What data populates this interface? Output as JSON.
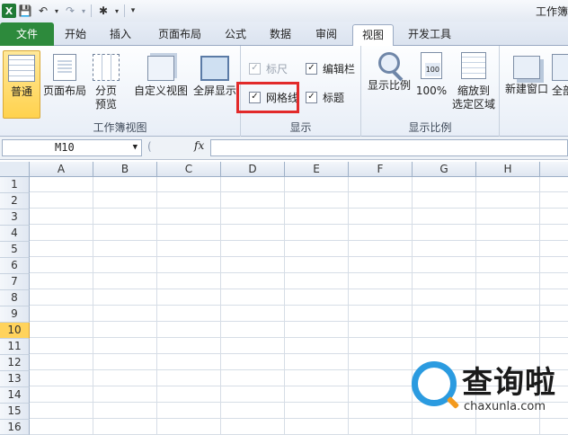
{
  "title_bar": {
    "window_title": "工作簿"
  },
  "tabs": [
    {
      "label": "文件"
    },
    {
      "label": "开始"
    },
    {
      "label": "插入"
    },
    {
      "label": "页面布局"
    },
    {
      "label": "公式"
    },
    {
      "label": "数据"
    },
    {
      "label": "审阅"
    },
    {
      "label": "视图"
    },
    {
      "label": "开发工具"
    }
  ],
  "active_tab": "视图",
  "ribbon": {
    "workbook_views": {
      "label": "工作簿视图",
      "normal": "普通",
      "page_layout": "页面布局",
      "page_break": [
        "分页",
        "预览"
      ],
      "custom_views": "自定义视图",
      "full_screen": "全屏显示"
    },
    "show": {
      "label": "显示",
      "ruler": {
        "label": "标尺",
        "checked": true,
        "enabled": false
      },
      "formula_bar": {
        "label": "编辑栏",
        "checked": true
      },
      "gridlines": {
        "label": "网格线",
        "checked": true
      },
      "headings": {
        "label": "标题",
        "checked": true
      }
    },
    "zoom": {
      "label": "显示比例",
      "zoom": "显示比例",
      "hundred": "100%",
      "hundred_icon_text": "100",
      "zoom_to_selection": [
        "缩放到",
        "选定区域"
      ]
    },
    "window": {
      "new_window": "新建窗口",
      "arrange_all": "全部"
    }
  },
  "formula_bar": {
    "name_box": "M10",
    "fx": "fx",
    "formula": ""
  },
  "sheet": {
    "columns": [
      "A",
      "B",
      "C",
      "D",
      "E",
      "F",
      "G",
      "H"
    ],
    "rows": [
      "1",
      "2",
      "3",
      "4",
      "5",
      "6",
      "7",
      "8",
      "9",
      "10",
      "11",
      "12",
      "13",
      "14",
      "15",
      "16"
    ],
    "selected_row": "10"
  },
  "watermark": {
    "brand": "查询啦",
    "domain": "chaxunla.com"
  },
  "colors": {
    "file_tab": "#2d8a3c",
    "highlight": "#e22a2a",
    "selected_row": "#ffd35c"
  }
}
